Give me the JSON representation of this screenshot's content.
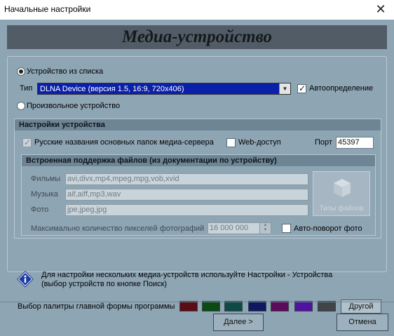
{
  "window": {
    "title": "Начальные настройки"
  },
  "banner": {
    "title": "Медиа-устройство"
  },
  "device_mode": {
    "from_list_label": "Устройство из списка",
    "type_label": "Тип",
    "selected_type": "DLNA Device (версия 1.5, 16:9, 720x406)",
    "autodetect_label": "Автоопределение",
    "custom_label": "Произвольное устройство"
  },
  "device_settings": {
    "header": "Настройки устройства",
    "russian_names_label": "Русские названия основных папок медиа-сервера",
    "web_access_label": "Web-доступ",
    "port_label": "Порт",
    "port_value": "45397"
  },
  "file_support": {
    "header": "Встроенная поддержка файлов (из документации по устройству)",
    "movies_label": "Фильмы",
    "movies_value": "avi,divx,mp4,mpeg,mpg,vob,xvid",
    "music_label": "Музыка",
    "music_value": "aif,aiff,mp3,wav",
    "photo_label": "Фото",
    "photo_value": "jpe,jpeg,jpg",
    "types_button_label": "Типы файлов",
    "max_pixels_label": "Максимально количество пикселей фотографий",
    "max_pixels_value": "16 000 000",
    "auto_rotate_label": "Авто-поворот фото"
  },
  "hint": {
    "line1": "Для настройки нескольких медиа-устройств используйте Настройки - Устройства",
    "line2": "(выбор устройств по кнопке Поиск)"
  },
  "palette": {
    "label": "Выбор палитры главной формы программы",
    "colors": [
      "#5a0d14",
      "#0b4a14",
      "#0e4a48",
      "#0e1760",
      "#5a0b5a",
      "#5212a0",
      "#3e4448"
    ],
    "other_label": "Другой"
  },
  "footer": {
    "next_label": "Далее >",
    "cancel_label": "Отмена"
  },
  "colors": {
    "background": "#8ea5b4",
    "banner": "#525c66",
    "selection": "#0b20a8"
  }
}
